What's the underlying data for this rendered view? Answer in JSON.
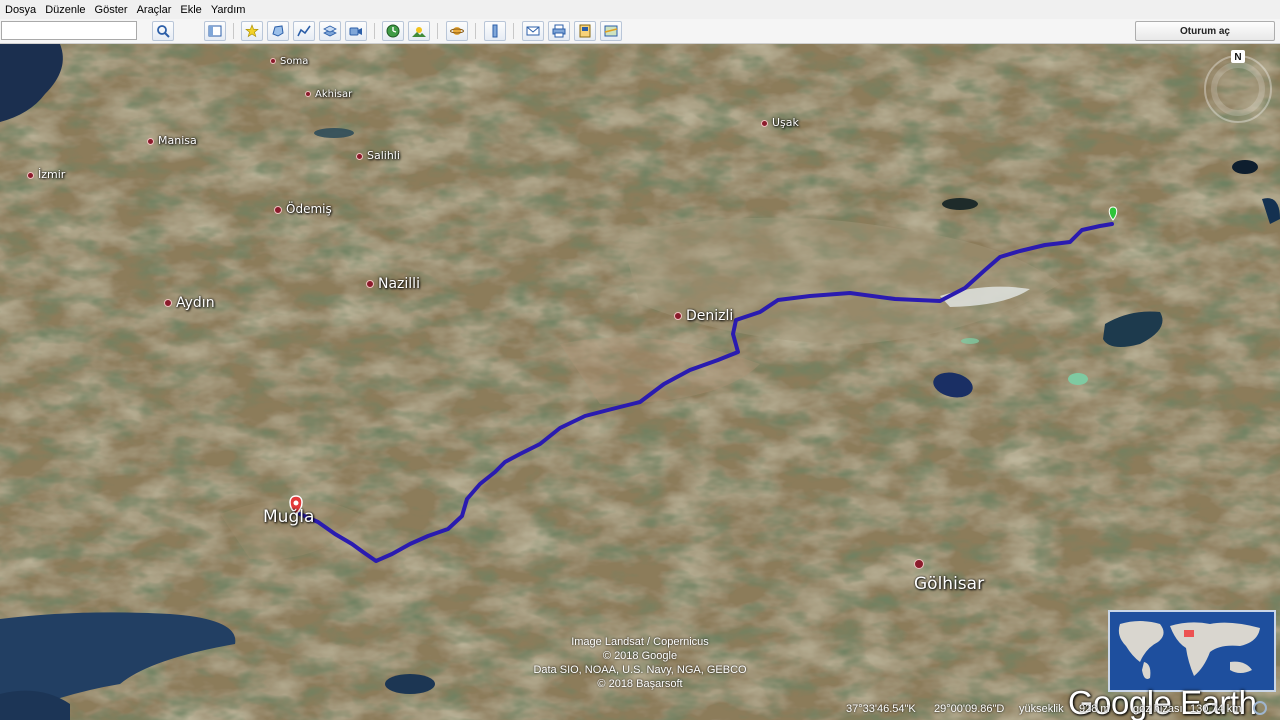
{
  "menu": {
    "file": "Dosya",
    "edit": "Düzenle",
    "view": "Göster",
    "tools": "Araçlar",
    "add": "Ekle",
    "help": "Yardım"
  },
  "toolbar": {
    "search_value": "",
    "sign_in": "Oturum aç"
  },
  "places": {
    "soma": "Soma",
    "akhisar": "Akhisar",
    "manisa": "Manisa",
    "salihli": "Salihli",
    "usak": "Uşak",
    "izmir": "İzmir",
    "odemis": "Ödemiş",
    "nazilli": "Nazilli",
    "aydin": "Aydın",
    "denizli": "Denizli",
    "mugla": "Muğla",
    "golhisar": "Gölhisar"
  },
  "attribution": {
    "line1": "Image Landsat / Copernicus",
    "line2": "© 2018 Google",
    "line3": "Data SIO, NOAA, U.S. Navy, NGA, GEBCO",
    "line4": "© 2018 Başarsoft"
  },
  "logo": "Google Earth",
  "compass_north": "N",
  "status": {
    "lat": "37°33'46.54\"K",
    "lon": "29°00'09.86\"D",
    "elev_label": "yükseklik",
    "elev_value": "928 m",
    "eye_label": "göz hizası",
    "eye_value": "130.74 km"
  },
  "icons": [
    "search-icon",
    "sidebar-icon",
    "placemark-icon",
    "polygon-icon",
    "path-icon",
    "overlay-icon",
    "tour-icon",
    "historical-imagery-icon",
    "sunlight-icon",
    "planets-icon",
    "ruler-icon",
    "email-icon",
    "print-icon",
    "save-image-icon",
    "maps-icon"
  ],
  "colors": {
    "route": "#2a1bb0",
    "start_pin": "#e23a3a",
    "end_pin": "#2ec43a"
  }
}
